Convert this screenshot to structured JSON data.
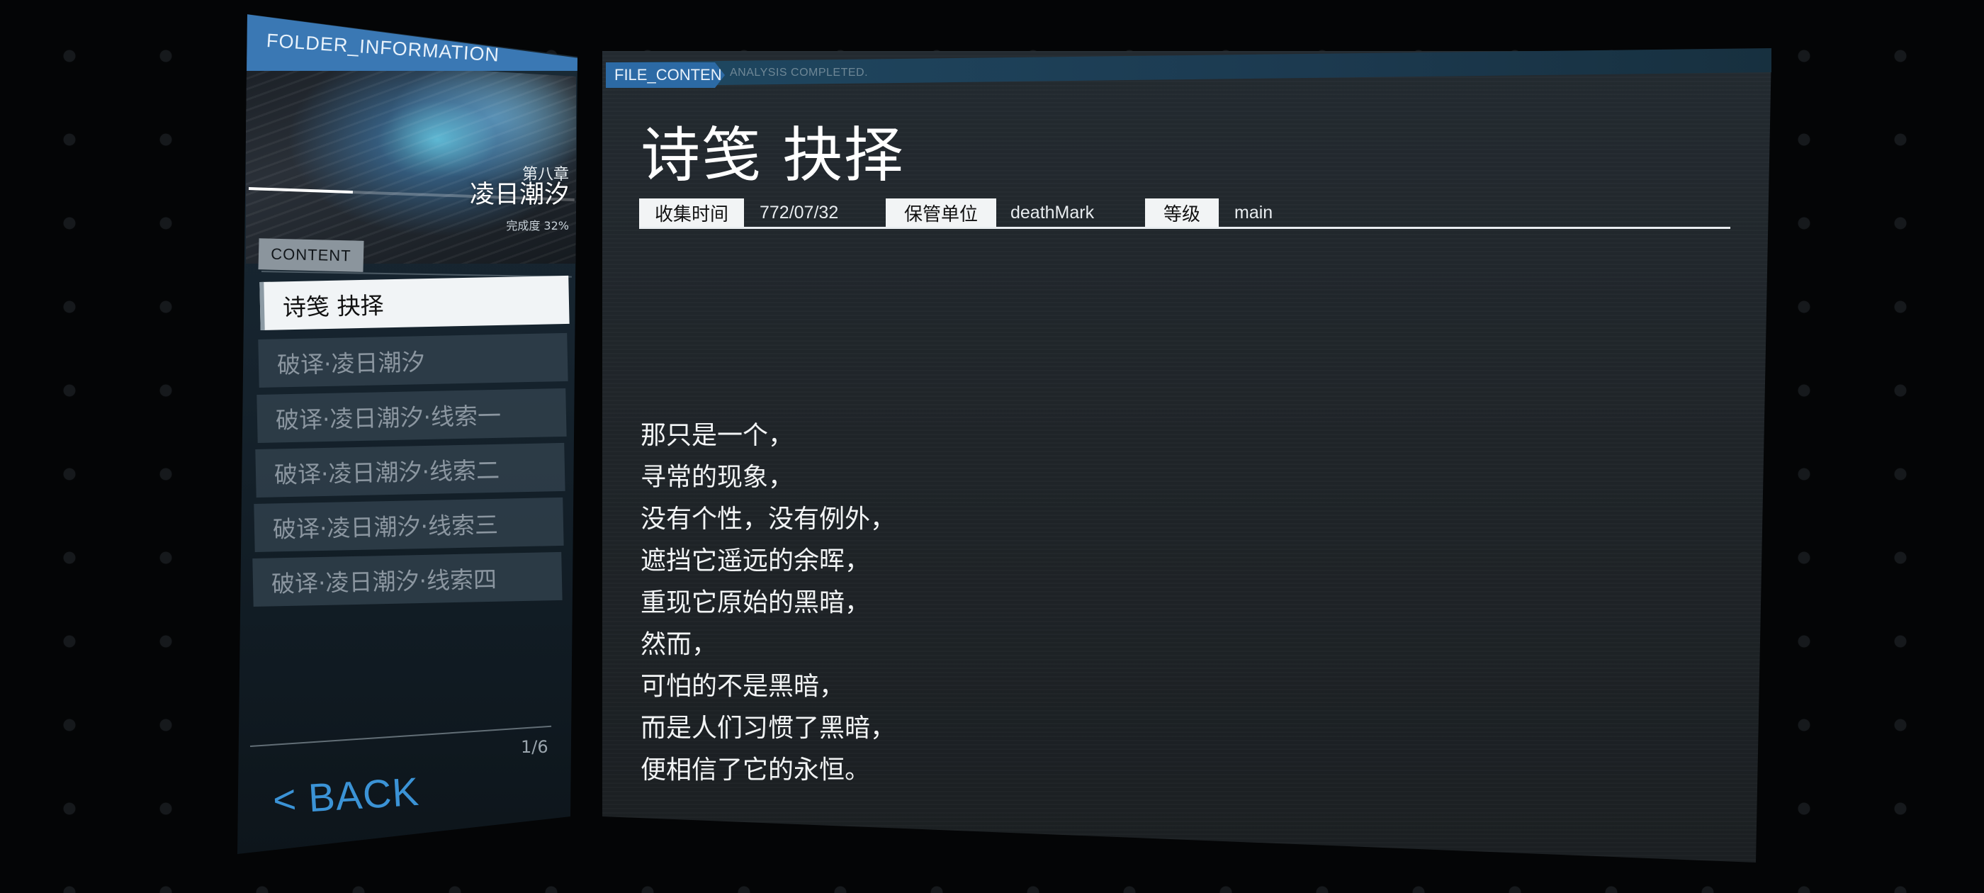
{
  "folder": {
    "header": "FOLDER_INFORMATION",
    "chapter_sub": "第八章",
    "chapter_title": "凌日潮汐",
    "progress_label": "完成度 32%",
    "progress_value": 0.32
  },
  "content_tab": "CONTENT",
  "menu": [
    {
      "label": "诗笺 抉择",
      "active": true
    },
    {
      "label": "破译·凌日潮汐",
      "active": false
    },
    {
      "label": "破译·凌日潮汐·线索一",
      "active": false
    },
    {
      "label": "破译·凌日潮汐·线索二",
      "active": false
    },
    {
      "label": "破译·凌日潮汐·线索三",
      "active": false
    },
    {
      "label": "破译·凌日潮汐·线索四",
      "active": false
    }
  ],
  "page_count": "1/6",
  "back_label": "< BACK",
  "file": {
    "tag": "FILE_CONTENT",
    "status": "ANALYSIS COMPLETED.",
    "title": "诗笺 抉择",
    "meta": {
      "collected_label": "收集时间",
      "collected_value": "772/07/32",
      "custodian_label": "保管单位",
      "custodian_value": "deathMark",
      "level_label": "等级",
      "level_value": "main"
    },
    "poem": [
      "那只是一个，",
      "寻常的现象，",
      "没有个性，没有例外，",
      "遮挡它遥远的余晖，",
      "重现它原始的黑暗，",
      "然而，",
      "可怕的不是黑暗，",
      "而是人们习惯了黑暗，",
      "便相信了它的永恒。"
    ]
  },
  "colors": {
    "accent_blue": "#3a78b4",
    "back_blue": "#3b93d6"
  }
}
